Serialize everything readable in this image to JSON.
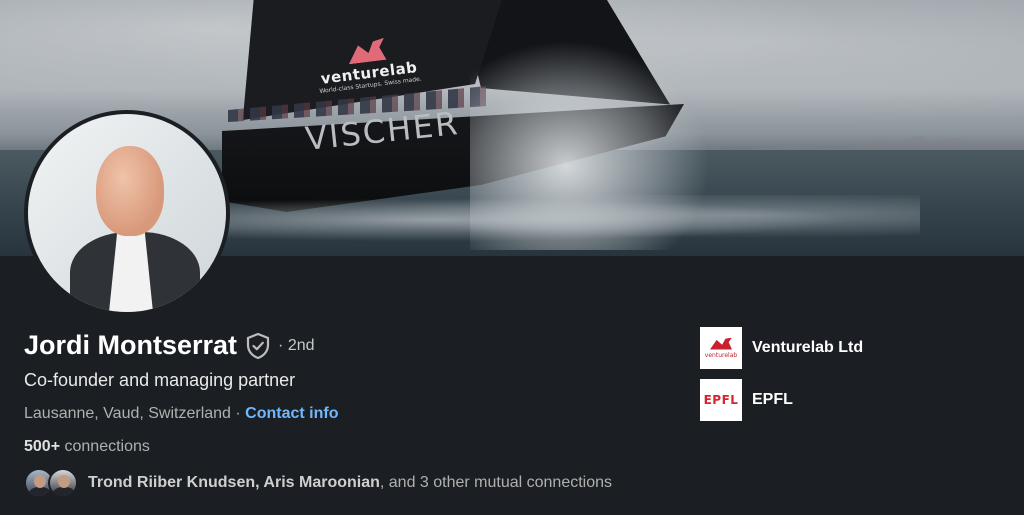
{
  "cover": {
    "sail_brand": "venturelab",
    "sail_tagline": "World-class Startups. Swiss made.",
    "hull_text": "VISCHER"
  },
  "profile": {
    "name": "Jordi Montserrat",
    "degree": "· 2nd",
    "headline": "Co-founder and managing partner",
    "location": "Lausanne, Vaud, Switzerland",
    "separator": " · ",
    "contact_info_label": "Contact info",
    "connections_count": "500+",
    "connections_label": " connections"
  },
  "mutual": {
    "names": "Trond Riiber Knudsen, Aris Maroonian",
    "rest": ", and 3 other mutual connections"
  },
  "organizations": [
    {
      "name": "Venturelab Ltd",
      "logo_text": "venturelab",
      "icon": "venturelab-logo-icon"
    },
    {
      "name": "EPFL",
      "logo_text": "EPFL",
      "icon": "epfl-logo-icon"
    }
  ],
  "colors": {
    "background": "#1b1f23",
    "link": "#71b7fb",
    "text_primary": "#ffffff",
    "text_secondary": "#b0b0b0"
  }
}
